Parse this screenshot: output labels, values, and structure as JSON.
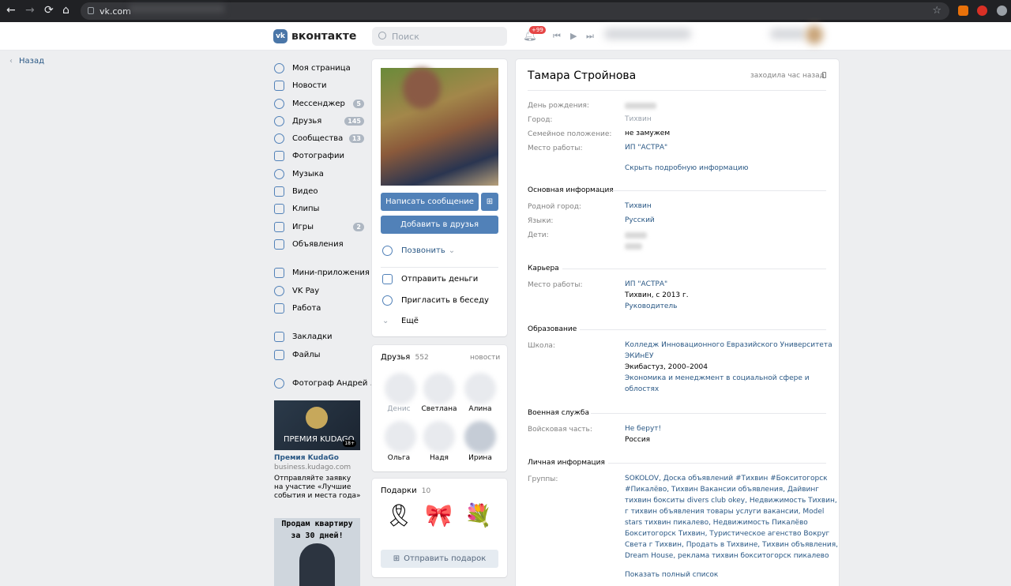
{
  "browser": {
    "url": "vk.com",
    "back": "←",
    "forward": "→",
    "reload": "⟳",
    "home": "⌂",
    "star": "☆"
  },
  "header": {
    "logo_letter": "vk",
    "logo_text": "вконтакте",
    "search_placeholder": "Поиск",
    "notif_badge": "+99",
    "prev": "⏮",
    "play": "▶",
    "next": "⏭"
  },
  "back_label": "Назад",
  "menu": [
    {
      "label": "Моя страница",
      "count": ""
    },
    {
      "label": "Новости",
      "count": ""
    },
    {
      "label": "Мессенджер",
      "count": "5"
    },
    {
      "label": "Друзья",
      "count": "145"
    },
    {
      "label": "Сообщества",
      "count": "13"
    },
    {
      "label": "Фотографии",
      "count": ""
    },
    {
      "label": "Музыка",
      "count": ""
    },
    {
      "label": "Видео",
      "count": ""
    },
    {
      "label": "Клипы",
      "count": ""
    },
    {
      "label": "Игры",
      "count": "2"
    },
    {
      "label": "Объявления",
      "count": ""
    },
    {
      "label": "Мини-приложения",
      "count": ""
    },
    {
      "label": "VK Pay",
      "count": ""
    },
    {
      "label": "Работа",
      "count": ""
    },
    {
      "label": "Закладки",
      "count": ""
    },
    {
      "label": "Файлы",
      "count": ""
    },
    {
      "label": "Фотограф Андрей ...",
      "count": ""
    }
  ],
  "ad": {
    "image_text": "ПРЕМИЯ KUDAGO",
    "age": "18+",
    "title": "Премия KudaGo",
    "domain": "business.kudago.com",
    "desc": "Отправляйте заявку на участие «Лучшие события и места года»"
  },
  "ad2": {
    "text_line1": "Продам квартиру",
    "text_line2": "за 30 дней!"
  },
  "profile_actions": {
    "write": "Написать сообщение",
    "gift_icon": "⊞",
    "add_friend": "Добавить в друзья",
    "call": "Позвонить",
    "send_money": "Отправить деньги",
    "invite": "Пригласить в беседу",
    "more": "Ещё"
  },
  "friends": {
    "title": "Друзья",
    "count": "552",
    "news": "новости",
    "names": [
      "Денис",
      "Светлана",
      "Алина",
      "Ольга",
      "Надя",
      "Ирина"
    ]
  },
  "gifts": {
    "title": "Подарки",
    "count": "10",
    "items": [
      "🎗",
      "🎀",
      "💐"
    ],
    "send": "Отправить подарок"
  },
  "profile": {
    "name": "Тамара Стройнова",
    "last_seen": "заходила час назад",
    "fields_top": [
      {
        "label": "День рождения:",
        "value": ""
      },
      {
        "label": "Город:",
        "value": "Тихвин"
      },
      {
        "label": "Семейное положение:",
        "value": "не замужем"
      },
      {
        "label": "Место работы:",
        "value": "ИП \"АСТРА\""
      }
    ],
    "hide_details": "Скрыть подробную информацию",
    "basic": {
      "title": "Основная информация",
      "home_label": "Родной город:",
      "home_value": "Тихвин",
      "lang_label": "Языки:",
      "lang_value": "Русский",
      "kids_label": "Дети:"
    },
    "career": {
      "title": "Карьера",
      "label": "Место работы:",
      "company": "ИП \"АСТРА\"",
      "place": "Тихвин, с 2013 г.",
      "position": "Руководитель"
    },
    "education": {
      "title": "Образование",
      "label": "Школа:",
      "school_l1": "Колледж Инновационного Евразийского Университета",
      "school_l2": "ЭКИнЕУ",
      "years": "Экибастуз, 2000–2004",
      "spec_l1": "Экономика и менеджмент в социальной сфере и",
      "spec_l2": "облостях"
    },
    "military": {
      "title": "Военная служба",
      "label": "Войсковая часть:",
      "unit": "Не берут!",
      "country": "Россия"
    },
    "personal": {
      "title": "Личная информация",
      "label": "Группы:",
      "groups": [
        "SOKOLOV, Доска объявлений #Тихвин #Бокситогорск",
        "#Пикалёво, Тихвин Вакансии объявления, Дайвинг",
        "тихвин бокситы divers club okey, Недвижимость Тихвин,",
        "г тихвин объявления товары услуги вакансии, Model",
        "stars тихвин пикалево, Недвижимость Пикалёво",
        "Бокситогорск Тихвин, Туристическое агенство Вокруг",
        "Света г Тихвин, Продать в Тихвине, Тихвин объявления,",
        "Dream House, реклама тихвин бокситогорск пикалево"
      ],
      "show_all": "Показать полный список"
    }
  }
}
